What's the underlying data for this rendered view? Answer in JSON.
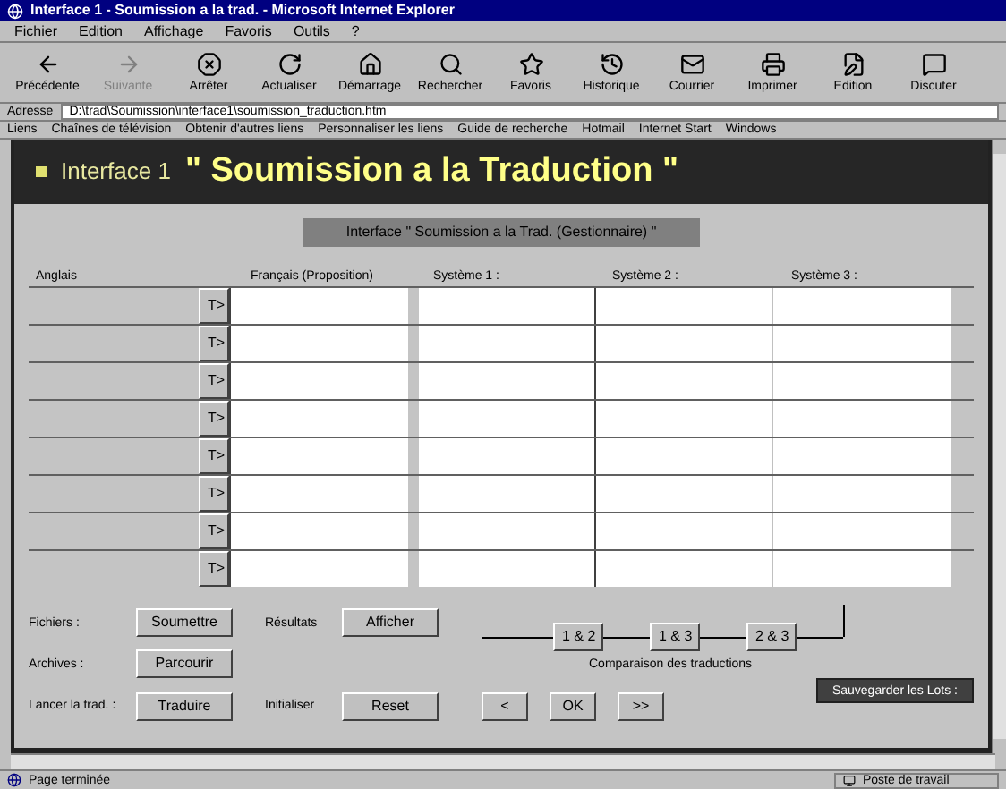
{
  "window": {
    "title": "Interface 1 - Soumission a la trad. - Microsoft Internet Explorer"
  },
  "menu_bar": [
    "Fichier",
    "Edition",
    "Affichage",
    "Favoris",
    "Outils",
    "?"
  ],
  "toolbar": [
    {
      "kind": "back",
      "label": "Précédente",
      "disabled": false
    },
    {
      "kind": "forward",
      "label": "Suivante",
      "disabled": true
    },
    {
      "kind": "stop",
      "label": "Arrêter",
      "disabled": false
    },
    {
      "kind": "refresh",
      "label": "Actualiser",
      "disabled": false
    },
    {
      "kind": "home",
      "label": "Démarrage",
      "disabled": false
    },
    {
      "kind": "search",
      "label": "Rechercher",
      "disabled": false
    },
    {
      "kind": "favorites",
      "label": "Favoris",
      "disabled": false
    },
    {
      "kind": "history",
      "label": "Historique",
      "disabled": false
    },
    {
      "kind": "mail",
      "label": "Courrier",
      "disabled": false
    },
    {
      "kind": "print",
      "label": "Imprimer",
      "disabled": false
    },
    {
      "kind": "edit",
      "label": "Edition",
      "disabled": false
    },
    {
      "kind": "discuss",
      "label": "Discuter",
      "disabled": false
    }
  ],
  "address": {
    "label": "Adresse",
    "value": "D:\\trad\\Soumission\\interface1\\soumission_traduction.htm"
  },
  "links": {
    "label": "Liens",
    "items": [
      "Chaînes de télévision",
      "Obtenir d'autres liens",
      "Personnaliser les liens",
      "Guide de recherche",
      "Hotmail",
      "Internet Start",
      "Windows"
    ]
  },
  "page": {
    "banner": {
      "prefix": "Interface 1",
      "title": "\" Soumission a la Traduction \""
    },
    "subtitle": "Interface \" Soumission a la Trad. (Gestionnaire) \"",
    "columns": [
      "Anglais",
      "Français (Proposition)",
      "Système 1 :",
      "Système 2 :",
      "Système 3 :"
    ],
    "rows": [
      {
        "button": "T>"
      },
      {
        "button": "T>"
      },
      {
        "button": "T>"
      },
      {
        "button": "T>"
      },
      {
        "button": "T>"
      },
      {
        "button": "T>"
      },
      {
        "button": "T>"
      },
      {
        "button": "T>"
      }
    ],
    "actions": [
      {
        "label": "Fichiers :",
        "button": "Soumettre",
        "label2": "Résultats",
        "button2": "Afficher"
      },
      {
        "label": "Archives :",
        "button": "Parcourir"
      },
      {
        "label": "Lancer la trad. :",
        "button": "Traduire",
        "label2": "Initialiser",
        "button2": "Reset"
      }
    ],
    "compare": {
      "buttons": [
        "1 & 2",
        "1 & 3",
        "2 & 3"
      ],
      "caption": "Comparaison des traductions"
    },
    "nav_buttons": [
      "<",
      "OK",
      ">>"
    ],
    "save_button": "Sauvegarder les Lots :"
  },
  "status_bar": {
    "text": "Page terminée",
    "zone": "Poste de travail"
  }
}
